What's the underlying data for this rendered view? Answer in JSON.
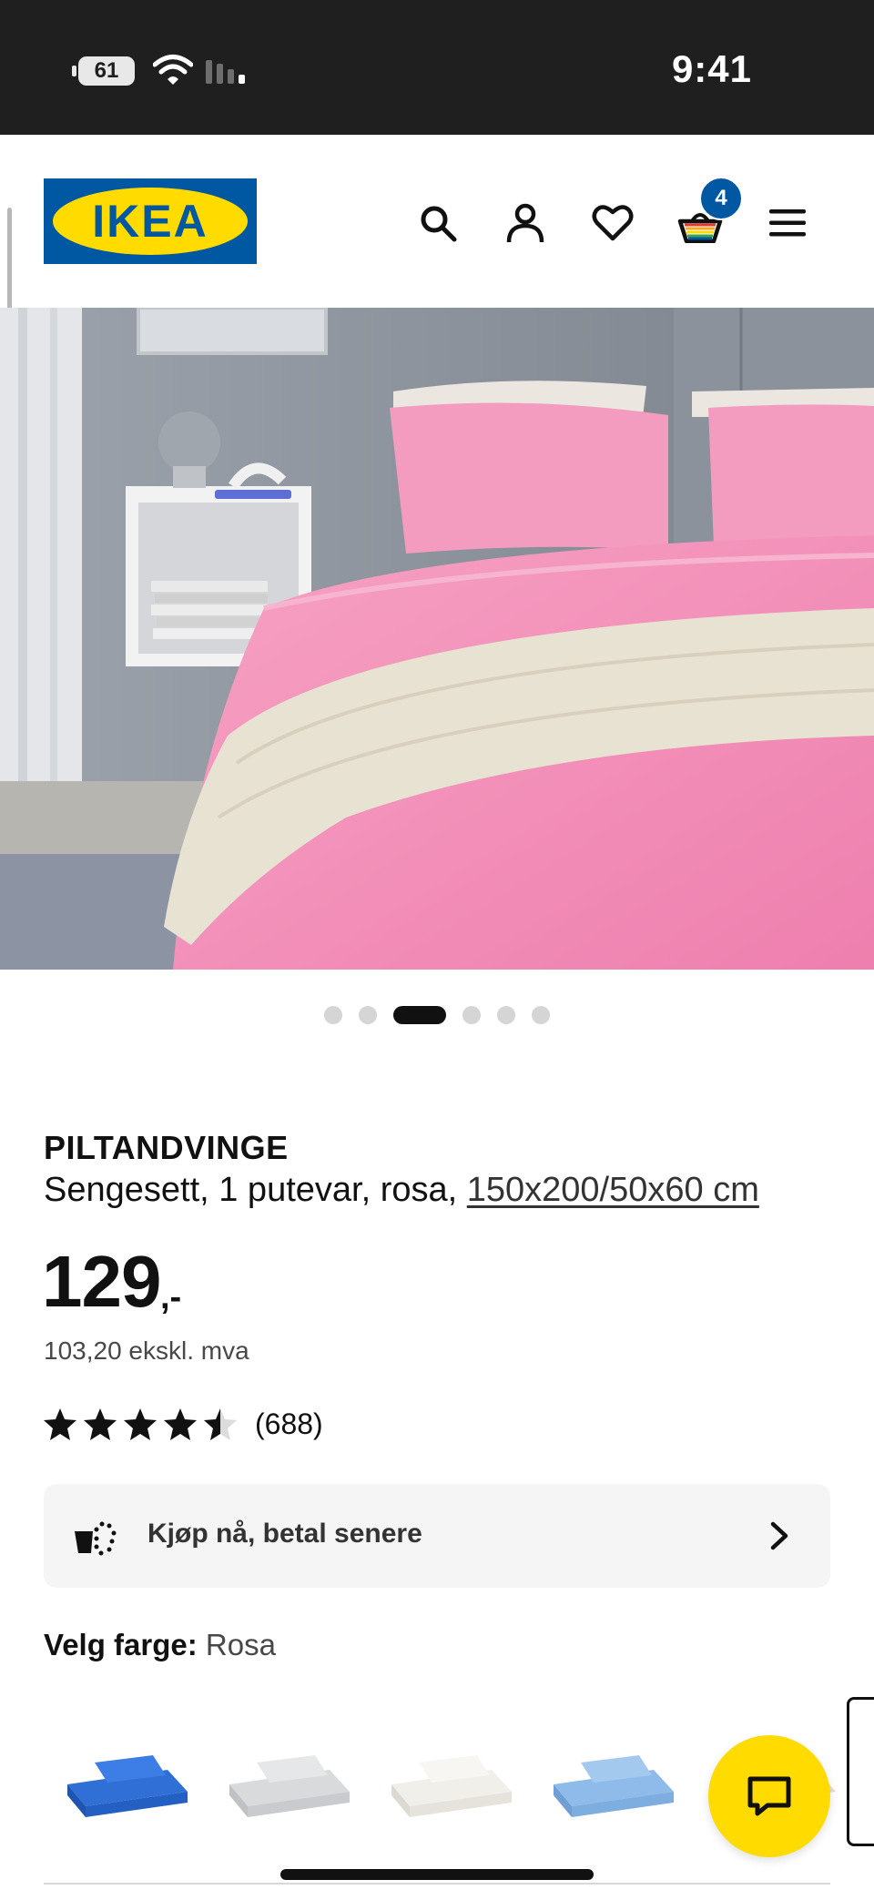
{
  "status_bar": {
    "battery": "61",
    "time": "9:41",
    "icons": [
      "battery-icon",
      "wifi-icon",
      "cellular-signal-icon"
    ]
  },
  "header": {
    "logo_text": "IKEA",
    "icons": [
      "search-icon",
      "account-icon",
      "heart-icon",
      "shopping-basket-icon",
      "hamburger-menu-icon"
    ],
    "cart_count": "4"
  },
  "gallery": {
    "image": "pink-bedding-bedroom-photo",
    "image_count": 6,
    "active_index": 2
  },
  "product": {
    "name": "PILTANDVINGE",
    "description": "Sengesett, 1 putevar, rosa,",
    "size": "150x200/50x60 cm",
    "price": "129",
    "price_suffix": ",-",
    "price_ex_vat": "103,20 ekskl. mva",
    "rating": 4.5,
    "rating_max": 5,
    "review_count": "(688)"
  },
  "bnpl": {
    "label": "Kjøp nå, betal senere",
    "icon": "basket-dotted-icon"
  },
  "color_picker": {
    "label": "Velg farge:",
    "selected": "Rosa",
    "swatches": [
      "blue-bedding",
      "grey-bedding",
      "white-bedding",
      "light-blue-bedding",
      "beige-bedding"
    ]
  },
  "colors": {
    "ikea_blue": "#0058a3",
    "ikea_yellow": "#ffdb00",
    "bedding_pink": "#f48bb6"
  }
}
